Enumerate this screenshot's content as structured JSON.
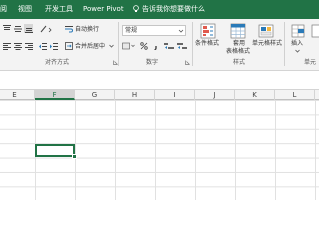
{
  "tabs": [
    "阅",
    "视图",
    "开发工具",
    "Power Pivot"
  ],
  "tell_me": "告诉我你想要做什么",
  "ribbon": {
    "wrap_text": "自动换行",
    "merge_center": "合并后居中",
    "number_format": "常规",
    "conditional_format": "条件格式",
    "format_as_table_line1": "套用",
    "format_as_table_line2": "表格格式",
    "cell_styles": "单元格样式",
    "insert": "插入",
    "group_alignment": "对齐方式",
    "group_number": "数字",
    "group_styles": "样式",
    "group_cells": "单元"
  },
  "columns": [
    {
      "letter": "E",
      "active": false
    },
    {
      "letter": "F",
      "active": true
    },
    {
      "letter": "G",
      "active": false
    },
    {
      "letter": "H",
      "active": false
    },
    {
      "letter": "I",
      "active": false
    },
    {
      "letter": "J",
      "active": false
    },
    {
      "letter": "K",
      "active": false
    },
    {
      "letter": "L",
      "active": false
    }
  ],
  "colors": {
    "accent": "#217346",
    "ribbon_bg": "#f3f3f3",
    "gridline": "#e1e1e1"
  }
}
